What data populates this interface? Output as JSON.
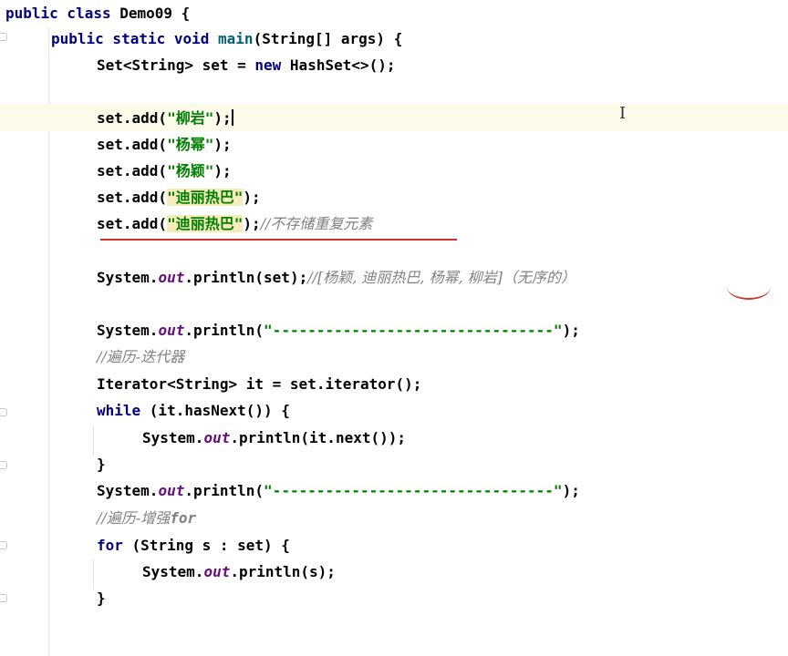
{
  "editor": {
    "lines": [
      {
        "id": "class-decl",
        "parts": [
          "public class ",
          "Demo09 {"
        ]
      },
      {
        "id": "main-decl",
        "parts": [
          "public static void ",
          "main",
          "(String[] args) {"
        ]
      },
      {
        "id": "set-decl",
        "parts": [
          "Set<String> set = ",
          "new ",
          "HashSet<>();"
        ]
      },
      {
        "id": "add-1",
        "parts": [
          "set.add(",
          "\"柳岩\"",
          ");"
        ]
      },
      {
        "id": "add-2",
        "parts": [
          "set.add(",
          "\"杨幂\"",
          ");"
        ]
      },
      {
        "id": "add-3",
        "parts": [
          "set.add(",
          "\"杨颖\"",
          ");"
        ]
      },
      {
        "id": "add-4",
        "parts": [
          "set.add(",
          "\"迪丽热巴\"",
          ");"
        ]
      },
      {
        "id": "add-5",
        "parts": [
          "set.add(",
          "\"迪丽热巴\"",
          ");",
          "//不存储重复元素"
        ]
      },
      {
        "id": "print-set",
        "parts": [
          "System.",
          "out",
          ".println(set);",
          "//[杨颖, 迪丽热巴, 杨幂, 柳岩]（无序的）"
        ]
      },
      {
        "id": "print-sep-1",
        "parts": [
          "System.",
          "out",
          ".println(",
          "\"--------------------------------\"",
          ");"
        ]
      },
      {
        "id": "comment-iterator",
        "parts": [
          "//遍历-迭代器"
        ]
      },
      {
        "id": "iterator-decl",
        "parts": [
          "Iterator<String> it = set.iterator();"
        ]
      },
      {
        "id": "while-loop",
        "parts": [
          "while ",
          "(it.hasNext()) {"
        ]
      },
      {
        "id": "print-next",
        "parts": [
          "System.",
          "out",
          ".println(it.next());"
        ]
      },
      {
        "id": "close-while",
        "parts": [
          "}"
        ]
      },
      {
        "id": "print-sep-2",
        "parts": [
          "System.",
          "out",
          ".println(",
          "\"--------------------------------\"",
          ");"
        ]
      },
      {
        "id": "comment-foreach",
        "parts": [
          "//遍历-增强",
          "for"
        ]
      },
      {
        "id": "for-loop",
        "parts": [
          "for ",
          "(String s : set) {"
        ]
      },
      {
        "id": "print-s",
        "parts": [
          "System.",
          "out",
          ".println(s);"
        ]
      },
      {
        "id": "close-for",
        "parts": [
          "}"
        ]
      }
    ]
  },
  "colors": {
    "keyword": "#000080",
    "string": "#008000",
    "static_field": "#660e7a",
    "comment": "#808080",
    "annotation_red": "#d0312d",
    "current_line": "#fcfae9",
    "string_highlight": "#f6ebbc"
  },
  "icons": {
    "text_cursor": "I"
  }
}
